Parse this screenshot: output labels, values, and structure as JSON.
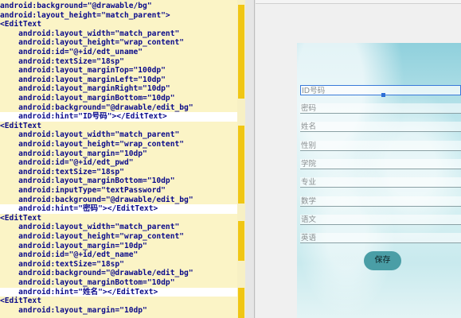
{
  "editor": {
    "lines": [
      {
        "text": "android:background=\"@drawable/bg\"",
        "hl": false
      },
      {
        "text": "android:layout_height=\"match_parent\">",
        "hl": false
      },
      {
        "text": "<EditText",
        "hl": false
      },
      {
        "text": "    android:layout_width=\"match_parent\"",
        "hl": false
      },
      {
        "text": "    android:layout_height=\"wrap_content\"",
        "hl": false
      },
      {
        "text": "    android:id=\"@+id/edt_uname\"",
        "hl": false
      },
      {
        "text": "    android:textSize=\"18sp\"",
        "hl": false
      },
      {
        "text": "    android:layout_marginTop=\"100dp\"",
        "hl": false
      },
      {
        "text": "    android:layout_marginLeft=\"10dp\"",
        "hl": false
      },
      {
        "text": "    android:layout_marginRight=\"10dp\"",
        "hl": false
      },
      {
        "text": "    android:layout_marginBottom=\"10dp\"",
        "hl": false
      },
      {
        "text": "    android:background=\"@drawable/edit_bg\"",
        "hl": false
      },
      {
        "text": "    android:hint=\"ID号码\"></EditText>",
        "hl": true
      },
      {
        "text": "<EditText",
        "hl": false
      },
      {
        "text": "    android:layout_width=\"match_parent\"",
        "hl": false
      },
      {
        "text": "    android:layout_height=\"wrap_content\"",
        "hl": false
      },
      {
        "text": "    android:layout_margin=\"10dp\"",
        "hl": false
      },
      {
        "text": "    android:id=\"@+id/edt_pwd\"",
        "hl": false
      },
      {
        "text": "    android:textSize=\"18sp\"",
        "hl": false
      },
      {
        "text": "    android:layout_marginBottom=\"10dp\"",
        "hl": false
      },
      {
        "text": "    android:inputType=\"textPassword\"",
        "hl": false
      },
      {
        "text": "    android:background=\"@drawable/edit_bg\"",
        "hl": false
      },
      {
        "text": "    android:hint=\"密码\"></EditText>",
        "hl": true
      },
      {
        "text": "<EditText",
        "hl": false
      },
      {
        "text": "    android:layout_width=\"match_parent\"",
        "hl": false
      },
      {
        "text": "    android:layout_height=\"wrap_content\"",
        "hl": false
      },
      {
        "text": "    android:layout_margin=\"10dp\"",
        "hl": false
      },
      {
        "text": "    android:id=\"@+id/edt_name\"",
        "hl": false
      },
      {
        "text": "    android:textSize=\"18sp\"",
        "hl": false
      },
      {
        "text": "    android:background=\"@drawable/edit_bg\"",
        "hl": false
      },
      {
        "text": "    android:layout_marginBottom=\"10dp\"",
        "hl": false
      },
      {
        "text": "    android:hint=\"姓名\"></EditText>",
        "hl": true
      },
      {
        "text": "<EditText",
        "hl": false
      },
      {
        "text": "    android:layout_margin=\"10dp\"",
        "hl": false
      }
    ]
  },
  "preview": {
    "fields": [
      {
        "hint": "ID号码",
        "selected": true
      },
      {
        "hint": "密码",
        "selected": false
      },
      {
        "hint": "姓名",
        "selected": false
      },
      {
        "hint": "性别",
        "selected": false
      },
      {
        "hint": "学院",
        "selected": false
      },
      {
        "hint": "专业",
        "selected": false
      },
      {
        "hint": "数学",
        "selected": false
      },
      {
        "hint": "语文",
        "selected": false
      },
      {
        "hint": "英语",
        "selected": false
      }
    ],
    "save_label": "保存"
  },
  "colors": {
    "editor_bg": "#fbf4c6",
    "marker": "#f0c614",
    "button": "#4a9ea6",
    "selection": "#3a7ad9"
  }
}
